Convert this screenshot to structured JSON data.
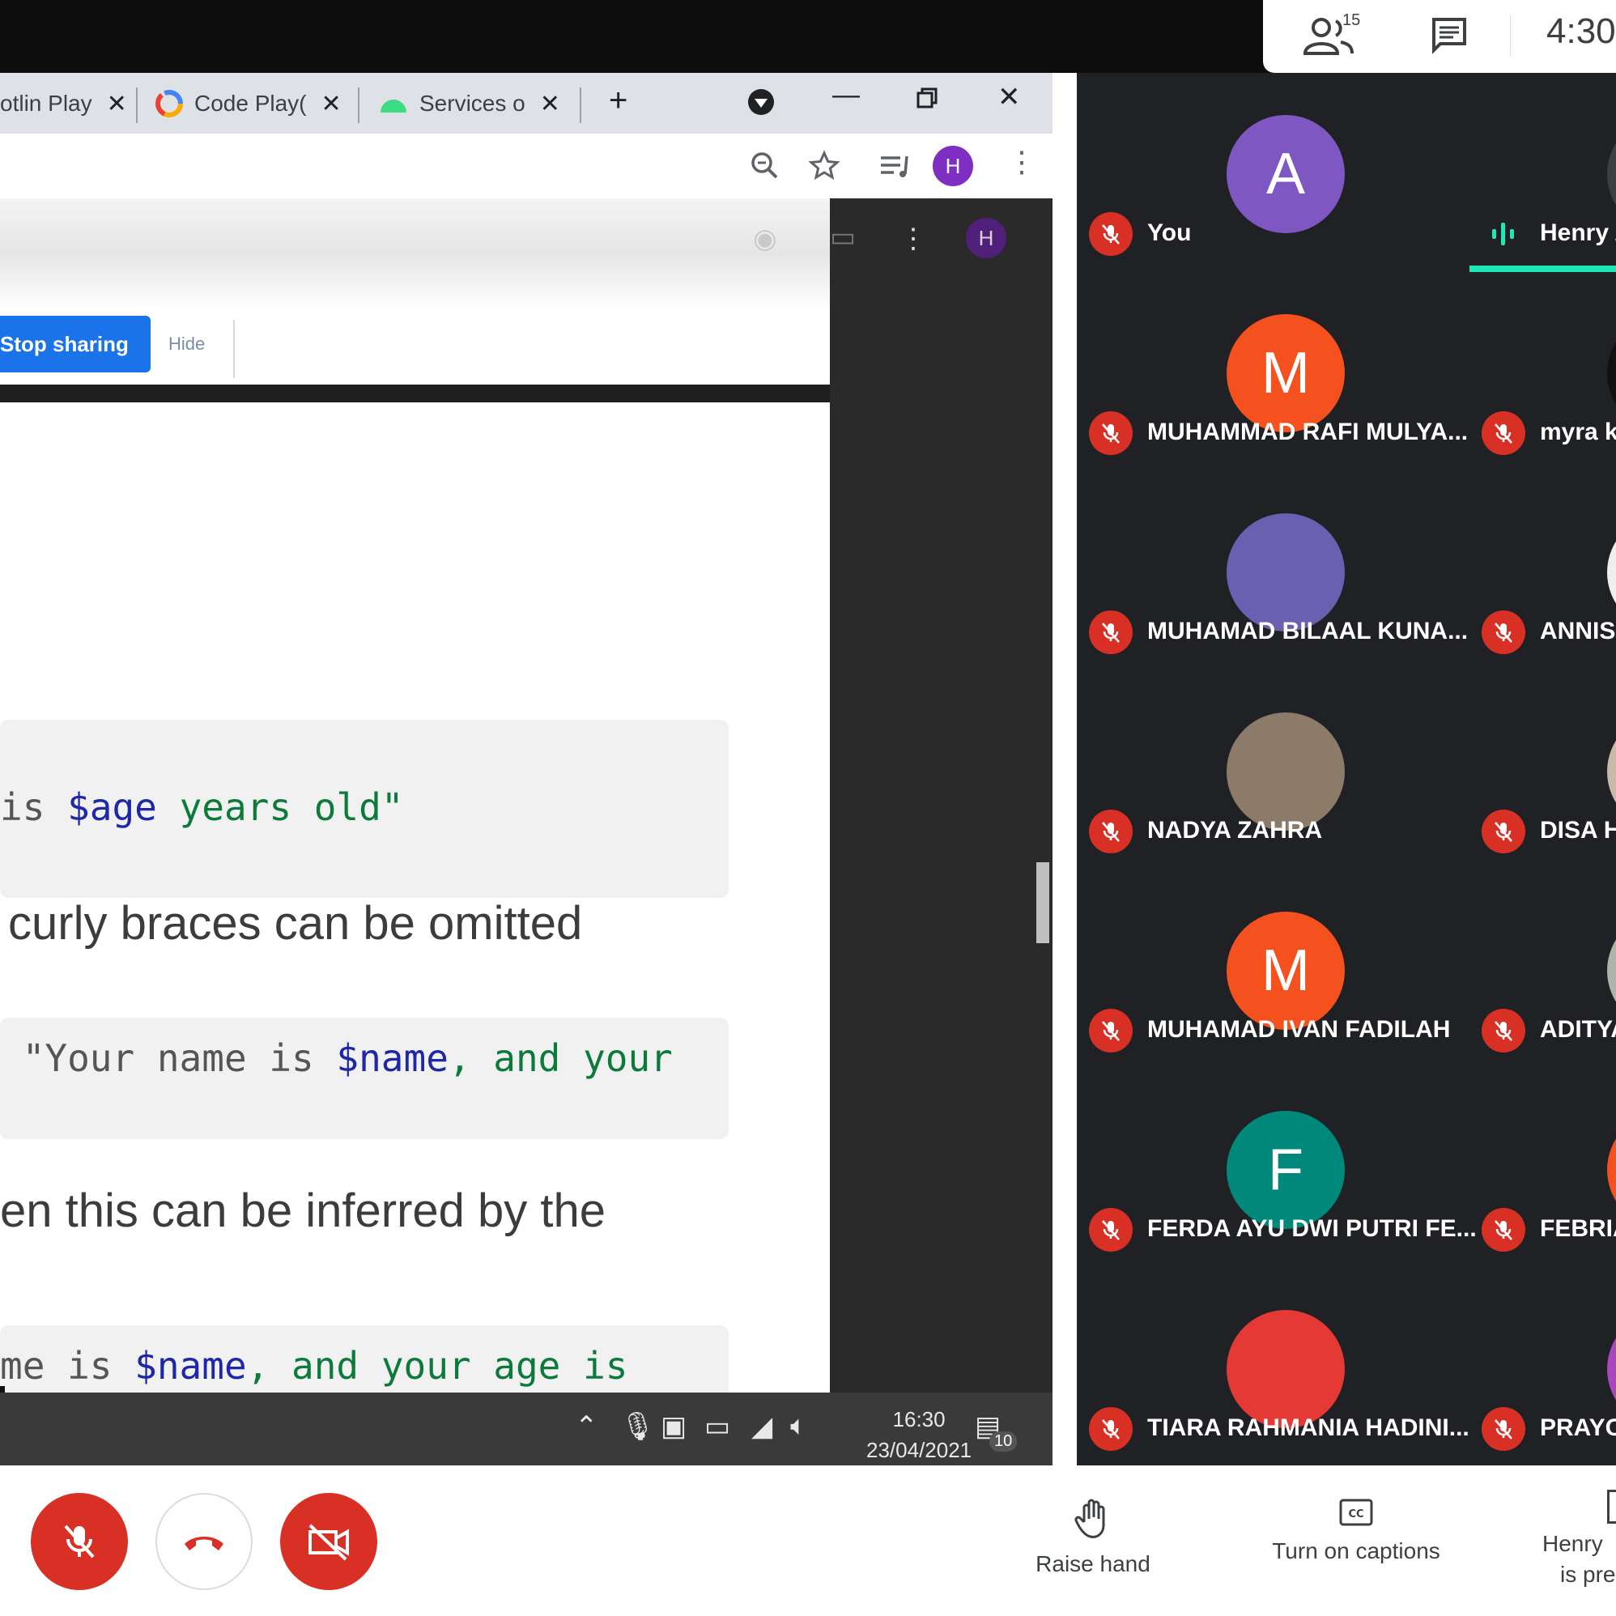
{
  "meet": {
    "participant_count": "15",
    "clock": "4:30"
  },
  "browser": {
    "tabs": [
      {
        "label": "otlin Play"
      },
      {
        "label": "Code Play("
      },
      {
        "label": "Services o"
      }
    ],
    "new_tab": "+",
    "profile_initial": "H"
  },
  "sharing": {
    "stop_label": "Stop sharing",
    "hide_label": "Hide"
  },
  "document": {
    "code1": {
      "pre": "is ",
      "var": "$age",
      "post": " years old\""
    },
    "para1": "curly braces can be omitted",
    "code2": {
      "pre": " \"Your name is ",
      "var": "$name",
      "post": ", and your"
    },
    "para2": "en this can be inferred by the",
    "code3": {
      "pre": "me is ",
      "var": "$name",
      "post": ", and your age is"
    }
  },
  "taskbar": {
    "time": "16:30",
    "date": "23/04/2021",
    "notification_count": "10"
  },
  "participants": [
    {
      "name": "You",
      "initial": "A",
      "color": "#7e57c2"
    },
    {
      "name": "Henry A",
      "initial": "",
      "color": "#3c4043",
      "speaking": true
    },
    {
      "name": "MUHAMMAD RAFI MULYA...",
      "initial": "M",
      "color": "#f4511e"
    },
    {
      "name": "myra ka",
      "initial": "",
      "color": "#111111"
    },
    {
      "name": "MUHAMAD BILAAL KUNA...",
      "initial": "",
      "color": "#6a5fb0"
    },
    {
      "name": "ANNISA",
      "initial": "",
      "color": "#eeeeee"
    },
    {
      "name": "NADYA ZAHRA",
      "initial": "",
      "color": "#8d7b6a"
    },
    {
      "name": "DISA H",
      "initial": "",
      "color": "#c9b9a9"
    },
    {
      "name": "MUHAMAD IVAN FADILAH",
      "initial": "M",
      "color": "#f4511e"
    },
    {
      "name": "ADITYA",
      "initial": "",
      "color": "#b0b3a8"
    },
    {
      "name": "FERDA AYU DWI PUTRI FE...",
      "initial": "F",
      "color": "#00897b"
    },
    {
      "name": "FEBRIA",
      "initial": "",
      "color": "#f4511e"
    },
    {
      "name": "TIARA RAHMANIA HADINI...",
      "initial": "",
      "color": "#e53935"
    },
    {
      "name": "PRAYO",
      "initial": "",
      "color": "#ab47bc"
    }
  ],
  "controls": {
    "raise_hand": "Raise hand",
    "captions": "Turn on captions",
    "presenting_line1": "Henry",
    "presenting_line2": "is pre"
  }
}
